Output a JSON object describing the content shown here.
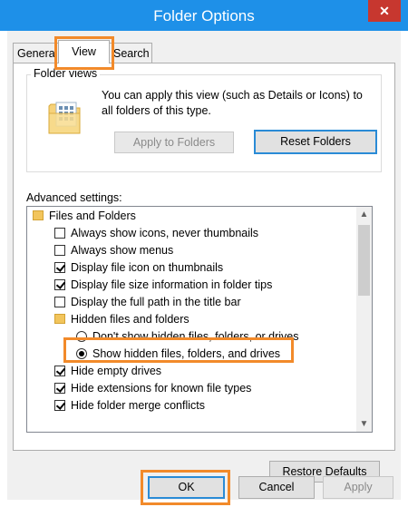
{
  "window": {
    "title": "Folder Options",
    "close_glyph": "✕"
  },
  "tabs": [
    {
      "label": "General"
    },
    {
      "label": "View"
    },
    {
      "label": "Search"
    }
  ],
  "folder_views": {
    "title": "Folder views",
    "description": "You can apply this view (such as Details or Icons) to all folders of this type.",
    "apply_button": "Apply to Folders",
    "reset_button": "Reset Folders"
  },
  "advanced": {
    "label": "Advanced settings:",
    "items": [
      {
        "kind": "folder",
        "text": "Files and Folders"
      },
      {
        "kind": "checkbox",
        "checked": false,
        "text": "Always show icons, never thumbnails"
      },
      {
        "kind": "checkbox",
        "checked": false,
        "text": "Always show menus"
      },
      {
        "kind": "checkbox",
        "checked": true,
        "text": "Display file icon on thumbnails"
      },
      {
        "kind": "checkbox",
        "checked": true,
        "text": "Display file size information in folder tips"
      },
      {
        "kind": "checkbox",
        "checked": false,
        "text": "Display the full path in the title bar"
      },
      {
        "kind": "folder",
        "text": "Hidden files and folders"
      },
      {
        "kind": "radio",
        "checked": false,
        "text": "Don't show hidden files, folders, or drives"
      },
      {
        "kind": "radio",
        "checked": true,
        "text": "Show hidden files, folders, and drives"
      },
      {
        "kind": "checkbox",
        "checked": true,
        "text": "Hide empty drives"
      },
      {
        "kind": "checkbox",
        "checked": true,
        "text": "Hide extensions for known file types"
      },
      {
        "kind": "checkbox",
        "checked": true,
        "text": "Hide folder merge conflicts"
      }
    ],
    "scroll_up_glyph": "▲",
    "scroll_down_glyph": "▼"
  },
  "restore_button": "Restore Defaults",
  "footer": {
    "ok": "OK",
    "cancel": "Cancel",
    "apply": "Apply"
  },
  "highlight_color": "#f28a2a",
  "accent_color": "#1e90e8"
}
